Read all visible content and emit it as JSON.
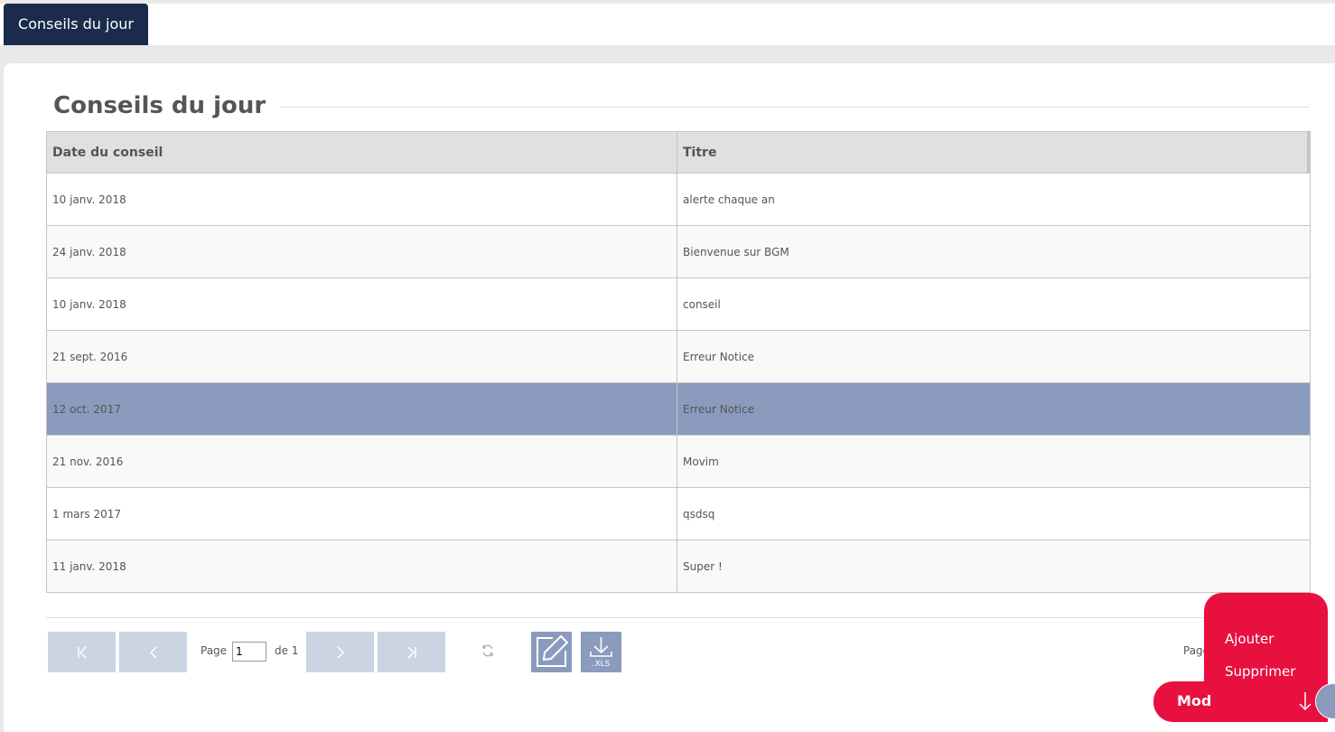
{
  "tabs": {
    "active_label": "Conseils du jour"
  },
  "page": {
    "title": "Conseils du jour"
  },
  "table": {
    "headers": {
      "date": "Date du conseil",
      "title": "Titre"
    },
    "rows": [
      {
        "date": "10 janv. 2018",
        "title": "alerte chaque an",
        "selected": false
      },
      {
        "date": "24 janv. 2018",
        "title": "Bienvenue sur BGM",
        "selected": false
      },
      {
        "date": "10 janv. 2018",
        "title": "conseil",
        "selected": false
      },
      {
        "date": "21 sept. 2016",
        "title": "Erreur Notice",
        "selected": false
      },
      {
        "date": "12 oct. 2017",
        "title": "Erreur Notice",
        "selected": true
      },
      {
        "date": "21 nov. 2016",
        "title": "Movim",
        "selected": false
      },
      {
        "date": "1 mars 2017",
        "title": "qsdsq",
        "selected": false
      },
      {
        "date": "11 janv. 2018",
        "title": "Super !",
        "selected": false
      }
    ]
  },
  "pager": {
    "page_label": "Page",
    "current_page": "1",
    "of_label": "de 1",
    "right_label": "Page",
    "first_icon": "first-page-icon",
    "prev_icon": "prev-page-icon",
    "next_icon": "next-page-icon",
    "last_icon": "last-page-icon",
    "refresh_icon": "refresh-icon",
    "edit_icon": "edit-icon",
    "xls_label": ".XLS"
  },
  "menu": {
    "items": [
      "Ajouter",
      "Supprimer"
    ],
    "fab_label": "Mod",
    "fab_icon": "arrow-down-icon"
  },
  "colors": {
    "nav_dark": "#1a2b4c",
    "accent_red": "#e8103f",
    "selected_row": "#8a9bbd",
    "pager_button": "#cbd4e3"
  }
}
